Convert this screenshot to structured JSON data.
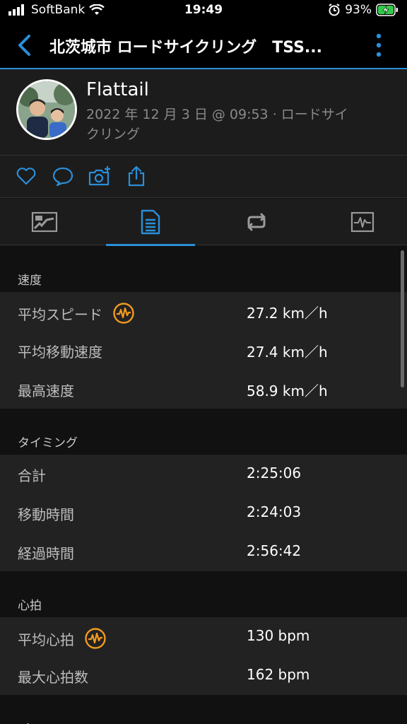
{
  "status": {
    "carrier": "SoftBank",
    "time": "19:49",
    "battery": "93%"
  },
  "nav": {
    "title": "北茨城市 ロードサイクリング　TSS..."
  },
  "profile": {
    "name": "Flattail",
    "meta": "2022 年 12 月 3 日 @ 09:53 · ロードサイクリング"
  },
  "colors": {
    "accent": "#2a8fd8",
    "badge": "#f29a1f"
  },
  "sections": {
    "speed": {
      "title": "速度",
      "rows": [
        {
          "label": "平均スピード",
          "value": "27.2 km／h"
        },
        {
          "label": "平均移動速度",
          "value": "27.4 km／h"
        },
        {
          "label": "最高速度",
          "value": "58.9 km／h"
        }
      ]
    },
    "timing": {
      "title": "タイミング",
      "rows": [
        {
          "label": "合計",
          "value": "2:25:06"
        },
        {
          "label": "移動時間",
          "value": "2:24:03"
        },
        {
          "label": "経過時間",
          "value": "2:56:42"
        }
      ]
    },
    "hr": {
      "title": "心拍",
      "rows": [
        {
          "label": "平均心拍",
          "value": "130 bpm"
        },
        {
          "label": "最大心拍数",
          "value": "162 bpm"
        }
      ]
    },
    "next": {
      "title": "パワ"
    }
  }
}
